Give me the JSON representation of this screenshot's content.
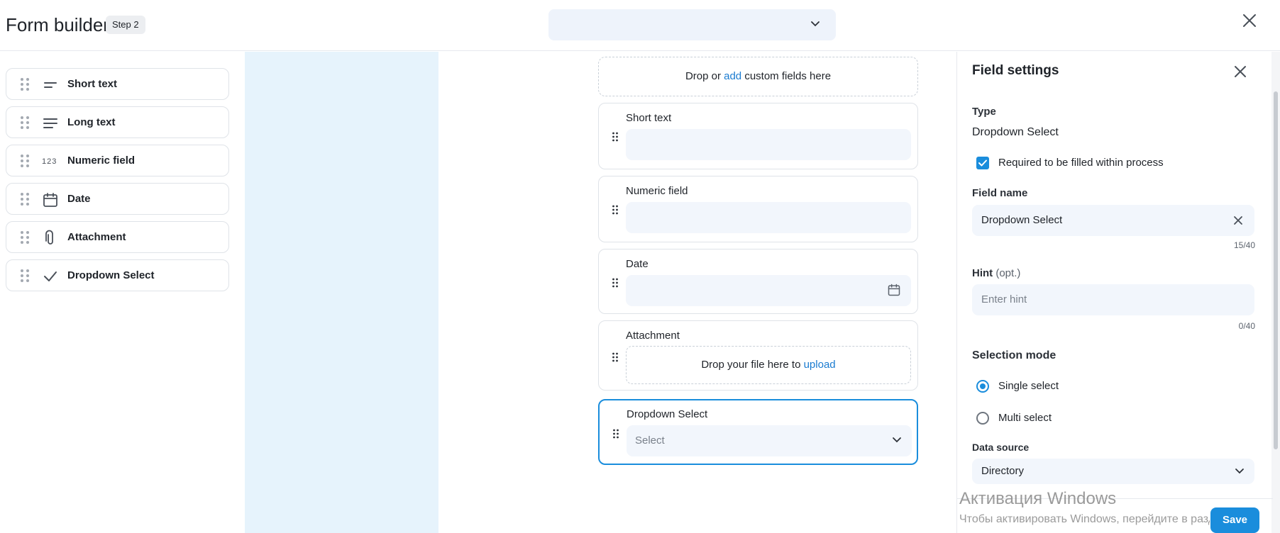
{
  "header": {
    "title": "Form builder",
    "step_badge": "Step 2"
  },
  "palette": {
    "items": [
      {
        "label": "Short text",
        "icon": "short-text-icon"
      },
      {
        "label": "Long text",
        "icon": "long-text-icon"
      },
      {
        "label": "Numeric field",
        "icon": "numeric-icon",
        "glyph": "123"
      },
      {
        "label": "Date",
        "icon": "calendar-icon"
      },
      {
        "label": "Attachment",
        "icon": "paperclip-icon"
      },
      {
        "label": "Dropdown Select",
        "icon": "check-icon"
      }
    ]
  },
  "canvas": {
    "drop_zone": {
      "before": "Drop or ",
      "link": "add",
      "after": " custom fields here"
    },
    "fields": [
      {
        "label": "Short text"
      },
      {
        "label": "Numeric field"
      },
      {
        "label": "Date"
      },
      {
        "label": "Attachment",
        "upload_text": "Drop your file here to ",
        "upload_link": "upload"
      },
      {
        "label": "Dropdown Select",
        "placeholder": "Select"
      }
    ]
  },
  "settings": {
    "title": "Field settings",
    "type_label": "Type",
    "type_value": "Dropdown Select",
    "required_label": "Required to be filled within process",
    "required_checked": true,
    "field_name_label": "Field name",
    "field_name_value": "Dropdown Select",
    "field_name_counter": "15/40",
    "hint_label": "Hint",
    "hint_optional": "(opt.)",
    "hint_placeholder": "Enter hint",
    "hint_counter": "0/40",
    "selection_mode_label": "Selection mode",
    "modes": [
      {
        "label": "Single select",
        "selected": true
      },
      {
        "label": "Multi select",
        "selected": false
      }
    ],
    "data_source_label": "Data source",
    "data_source_value": "Directory",
    "save_label": "Save"
  },
  "windows_overlay": {
    "title": "Активация Windows",
    "subtitle": "Чтобы активировать Windows, перейдите в раздел"
  },
  "colors": {
    "accent": "#1a8ddc",
    "link": "#1a7bd0",
    "input_bg": "#f2f6fc",
    "side_blue": "#e6f3fc"
  }
}
